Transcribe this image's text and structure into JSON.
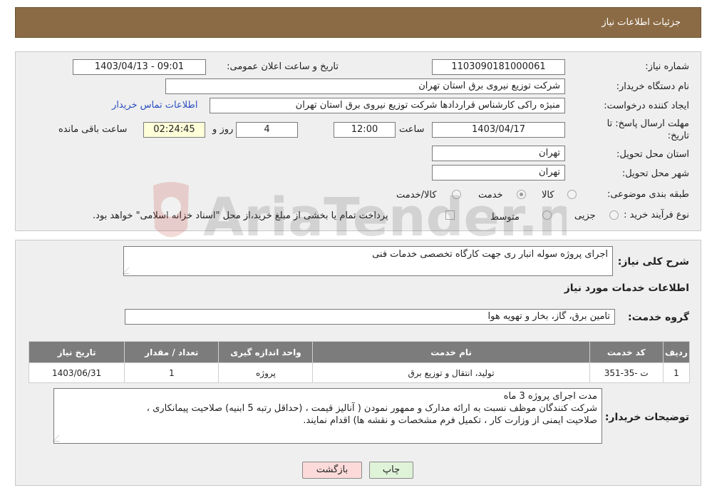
{
  "header": {
    "title": "جزئیات اطلاعات نیاز"
  },
  "form": {
    "need_number_label": "شماره نیاز:",
    "need_number": "1103090181000061",
    "announce_label": "تاریخ و ساعت اعلان عمومی:",
    "announce_value": "1403/04/13 - 09:01",
    "buyer_label": "نام دستگاه خریدار:",
    "buyer_value": "شرکت توزیع نیروی برق استان تهران",
    "creator_label": "ایجاد کننده درخواست:",
    "creator_value": "منیژه راکی کارشناس قراردادها شرکت توزیع نیروی برق استان تهران",
    "contact_link": "اطلاعات تماس خریدار",
    "deadline_label_1": "مهلت ارسال پاسخ: تا",
    "deadline_label_2": "تاریخ:",
    "deadline_date": "1403/04/17",
    "time_label": "ساعت",
    "deadline_time": "12:00",
    "days_value": "4",
    "days_label": "روز و",
    "remaining_time": "02:24:45",
    "remaining_label": "ساعت باقی مانده",
    "province_label": "استان محل تحویل:",
    "province_value": "تهران",
    "city_label": "شهر محل تحویل:",
    "city_value": "تهران",
    "category_label": "طبقه بندی موضوعی:",
    "category_options": [
      "کالا",
      "خدمت",
      "کالا/خدمت"
    ],
    "category_selected": "خدمت",
    "process_label": "نوع فرآیند خرید :",
    "process_options": [
      "جزیی",
      "متوسط"
    ],
    "payment_note": "پرداخت تمام یا بخشی از مبلغ خرید،از محل \"اسناد خزانه اسلامی\" خواهد بود."
  },
  "details": {
    "summary_label": "شرح کلی نیاز:",
    "summary_value": "اجرای پروژه سوله انبار ری جهت کارگاه تخصصی خدمات فنی",
    "services_title": "اطلاعات خدمات مورد نیاز",
    "group_label": "گروه خدمت:",
    "group_value": "تامین برق، گاز، بخار و تهویه هوا",
    "table": {
      "headers": [
        "ردیف",
        "کد خدمت",
        "نام خدمت",
        "واحد اندازه گیری",
        "تعداد / مقدار",
        "تاریخ نیاز"
      ],
      "rows": [
        [
          "1",
          "ت -35-351",
          "تولید، انتقال و توزیع برق",
          "پروژه",
          "1",
          "1403/06/31"
        ]
      ]
    },
    "buyer_notes_label": "توضیحات خریدار:",
    "buyer_notes_lines": [
      "مدت اجرای پروژه 3 ماه",
      "شرکت کنندگان موظف نسبت به ارائه مدارک و ممهور نمودن ( آنالیز قیمت ، (حداقل رتبه 5 ابنیه) صلاحیت پیمانکاری ،",
      "صلاحیت ایمنی از وزارت کار ، تکمیل فرم مشخصات و نقشه ها) اقدام نمایند."
    ]
  },
  "buttons": {
    "print": "چاپ",
    "back": "بازگشت"
  },
  "watermark": {
    "text": "AriaTender.neT"
  },
  "colors": {
    "header": "#8b6b45",
    "table_header": "#7c7c7c",
    "panel": "#efefef",
    "link": "#2a4fbf"
  }
}
